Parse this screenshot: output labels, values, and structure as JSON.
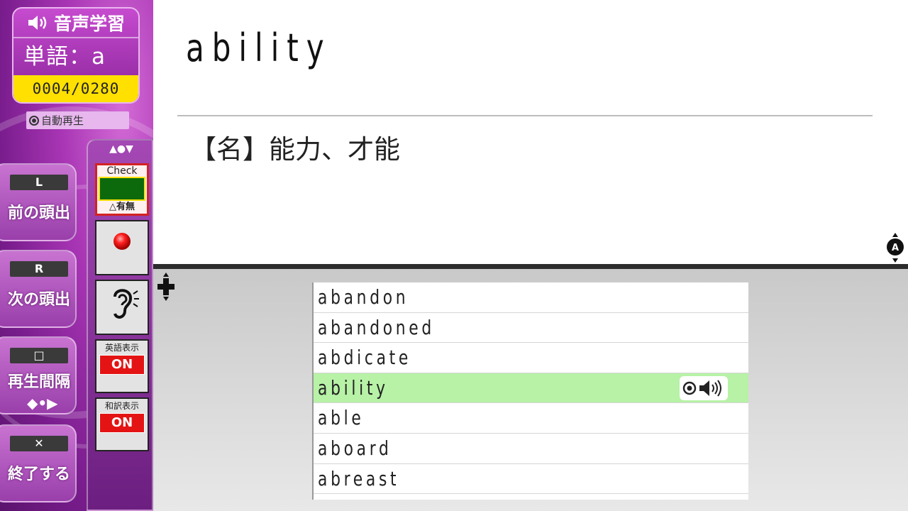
{
  "header": {
    "mode_title": "音声学習",
    "word_label": "単語：a",
    "counter": "0004/0280",
    "autoplay_label": "自動再生"
  },
  "side_buttons": [
    {
      "key": "L",
      "label": "前の頭出"
    },
    {
      "key": "R",
      "label": "次の頭出"
    },
    {
      "key": "□",
      "label": "再生間隔",
      "sub": "◆•▶"
    },
    {
      "key": "✕",
      "label": "終了する"
    }
  ],
  "icon_strip": {
    "scroll_head": "▲●▼",
    "check_title": "Check",
    "check_toggle": "△有無",
    "english_display": {
      "label": "英語表示",
      "state": "ON"
    },
    "japanese_display": {
      "label": "和訳表示",
      "state": "ON"
    }
  },
  "entry": {
    "headword": "ability",
    "definition": "【名】能力、才能"
  },
  "word_list": {
    "items": [
      "abandon",
      "abandoned",
      "abdicate",
      "ability",
      "able",
      "aboard",
      "abreast"
    ],
    "selected_index": 3
  },
  "colors": {
    "panel_purple": "#a936b5",
    "counter_yellow": "#ffe000",
    "selected_row": "#b7f2a6",
    "on_red": "#e41414"
  }
}
